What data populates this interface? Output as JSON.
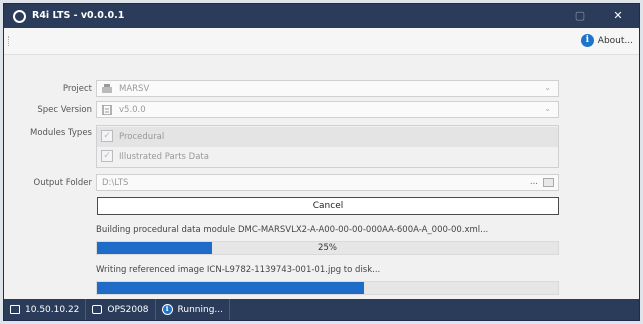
{
  "window": {
    "title": "R4i LTS - v0.0.0.1",
    "close_glyph": "✕",
    "restore_glyph": "▢"
  },
  "menu": {
    "about_label": "About...",
    "about_icon": "info-icon"
  },
  "form": {
    "project_label": "Project",
    "project_value": "MARSV",
    "spec_label": "Spec Version",
    "spec_value": "v5.0.0",
    "modules_label": "Modules Types",
    "modules": [
      {
        "label": "Procedural",
        "checked": true,
        "selected": true
      },
      {
        "label": "Illustrated Parts Data",
        "checked": true,
        "selected": false
      }
    ],
    "output_label": "Output Folder",
    "output_value": "D:\\LTS",
    "output_ellipsis": "...",
    "dropdown_glyph": "⌄"
  },
  "actions": {
    "cancel_label": "Cancel"
  },
  "progress": {
    "status1": "Building procedural data module DMC-MARSVLX2-A-A00-00-00-000AA-600A-A_000-00.xml...",
    "bar1_percent": 25,
    "bar1_label": "25%",
    "status2": "Writing referenced image ICN-L9782-1139743-001-01.jpg to disk...",
    "bar2_percent": 58
  },
  "statusbar": {
    "ip": "10.50.10.22",
    "host": "OPS2008",
    "state": "Running..."
  },
  "colors": {
    "titlebar": "#2b3c5b",
    "accent": "#1e6cc7",
    "window_bg": "#f1f1f1"
  }
}
